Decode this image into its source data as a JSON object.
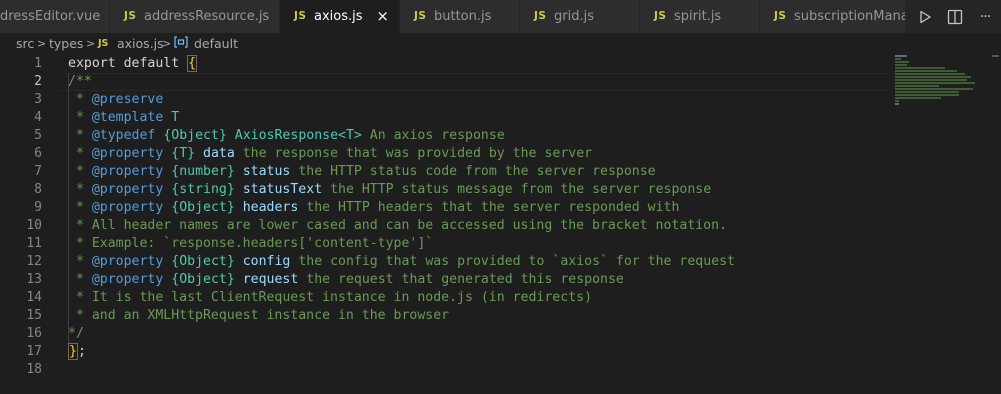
{
  "tabs": [
    {
      "icon": "",
      "label": "dressEditor.vue",
      "active": false
    },
    {
      "icon": "JS",
      "label": "addressResource.js",
      "active": false
    },
    {
      "icon": "JS",
      "label": "axios.js",
      "active": true,
      "close": "×"
    },
    {
      "icon": "JS",
      "label": "button.js",
      "active": false
    },
    {
      "icon": "JS",
      "label": "grid.js",
      "active": false
    },
    {
      "icon": "JS",
      "label": "spirit.js",
      "active": false
    },
    {
      "icon": "JS",
      "label": "subscriptionManag",
      "active": false
    }
  ],
  "tab_actions": {
    "run_icon": "run-icon",
    "split_icon": "split-editor-icon",
    "more_icon": "more-actions-icon",
    "more_label": "···"
  },
  "breadcrumb": {
    "segments": [
      "src",
      "types",
      "axios.js",
      "default"
    ],
    "separator": ">",
    "file_icon": "JS",
    "symbol_icon": "symbol-variable-icon"
  },
  "editor": {
    "line_numbers": [
      "1",
      "2",
      "3",
      "4",
      "5",
      "6",
      "7",
      "8",
      "9",
      "10",
      "11",
      "12",
      "13",
      "14",
      "15",
      "16",
      "17",
      "18"
    ],
    "lines": [
      "export default {",
      "/**",
      " * @preserve",
      " * @template T",
      " * @typedef {Object} AxiosResponse<T> An axios response",
      " * @property {T} data the response that was provided by the server",
      " * @property {number} status the HTTP status code from the server response",
      " * @property {string} statusText the HTTP status message from the server response",
      " * @property {Object} headers the HTTP headers that the server responded with",
      " * All header names are lower cased and can be accessed using the bracket notation.",
      " * Example: `response.headers['content-type']`",
      " * @property {Object} config the config that was provided to `axios` for the request",
      " * @property {Object} request the request that generated this response",
      " * It is the last ClientRequest instance in node.js (in redirects)",
      " * and an XMLHttpRequest instance in the browser",
      "*/",
      "};",
      ""
    ],
    "tokens": {
      "l1": {
        "kw1": "export",
        "kw2": "default",
        "brace": "{"
      },
      "l2": {
        "c": "/**"
      },
      "l3": {
        "star": " * ",
        "tag": "@preserve"
      },
      "l4": {
        "star": " * ",
        "tag": "@template",
        "rest": " T"
      },
      "l5": {
        "star": " * ",
        "tag": "@typedef",
        "type": "{Object}",
        "name": "AxiosResponse<T>",
        "desc": " An axios response"
      },
      "l6": {
        "star": " * ",
        "tag": "@property",
        "type": "{T}",
        "name": "data",
        "desc": " the response that was provided by the server"
      },
      "l7": {
        "star": " * ",
        "tag": "@property",
        "type": "{number}",
        "name": "status",
        "desc": " the HTTP status code from the server response"
      },
      "l8": {
        "star": " * ",
        "tag": "@property",
        "type": "{string}",
        "name": "statusText",
        "desc": " the HTTP status message from the server response"
      },
      "l9": {
        "star": " * ",
        "tag": "@property",
        "type": "{Object}",
        "name": "headers",
        "desc": " the HTTP headers that the server responded with"
      },
      "l10": {
        "c": " * All header names are lower cased and can be accessed using the bracket notation."
      },
      "l11": {
        "c": " * Example: `response.headers['content-type']`"
      },
      "l12": {
        "star": " * ",
        "tag": "@property",
        "type": "{Object}",
        "name": "config",
        "desc": " the config that was provided to `axios` for the request"
      },
      "l13": {
        "star": " * ",
        "tag": "@property",
        "type": "{Object}",
        "name": "request",
        "desc": " the request that generated this response"
      },
      "l14": {
        "c": " * It is the last ClientRequest instance in node.js (in redirects)"
      },
      "l15": {
        "c": " * and an XMLHttpRequest instance in the browser"
      },
      "l16": {
        "c": "*/"
      },
      "l17": {
        "brace": "}",
        "semi": ";"
      }
    }
  },
  "colors": {
    "background": "#1e1e1e",
    "tabbar": "#252526",
    "comment": "#6a9955",
    "keyword": "#c586c0",
    "jsdoc_tag": "#569cd6",
    "jsdoc_type": "#4ec9b0",
    "jsdoc_param": "#9cdcfe",
    "js_icon": "#cbcb41"
  }
}
